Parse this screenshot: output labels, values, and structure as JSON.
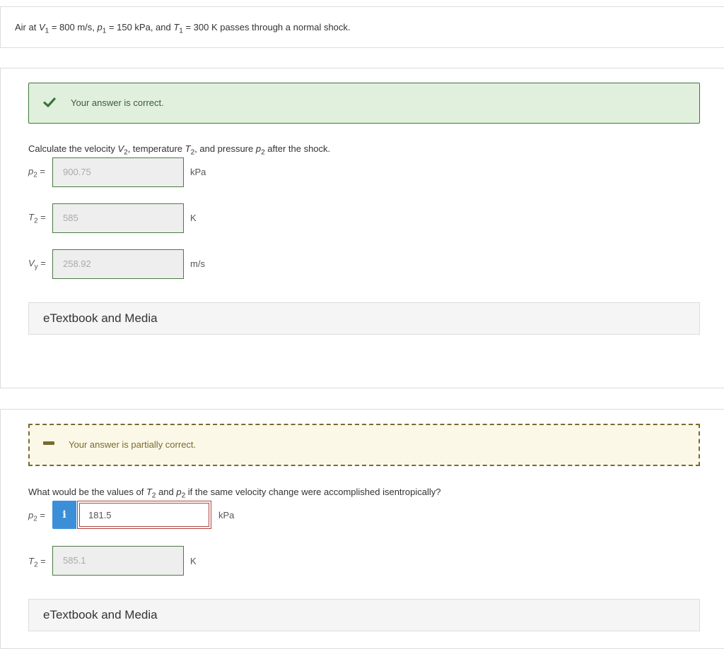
{
  "problem": {
    "prefix": "Air at ",
    "v1_sym": "V",
    "v1_sub": "1",
    "v1_val": " = 800 m/s, ",
    "p1_sym": "p",
    "p1_sub": "1",
    "p1_val": " = 150 kPa, and ",
    "t1_sym": "T",
    "t1_sub": "1",
    "t1_val": " = 300 K passes through a normal shock."
  },
  "part1": {
    "banner_text": "Your answer is correct.",
    "q_a": "Calculate the velocity ",
    "q_v": "V",
    "q_v_sub": "2",
    "q_b": ", temperature ",
    "q_t": "T",
    "q_t_sub": "2",
    "q_c": ", and pressure ",
    "q_p": "p",
    "q_p_sub": "2",
    "q_d": " after the shock.",
    "rows": [
      {
        "sym": "p",
        "sub": "2",
        "eq": " =",
        "value": "900.75",
        "unit": "kPa"
      },
      {
        "sym": "T",
        "sub": "2",
        "eq": " =",
        "value": "585",
        "unit": "K"
      },
      {
        "sym": "V",
        "sub": "y",
        "eq": " =",
        "value": "258.92",
        "unit": "m/s"
      }
    ],
    "media_label": "eTextbook and Media"
  },
  "part2": {
    "banner_text": "Your answer is partially correct.",
    "q_a": "What would be the values of ",
    "q_t": "T",
    "q_t_sub": "2",
    "q_b": " and ",
    "q_p": "p",
    "q_p_sub": "2",
    "q_c": " if the same velocity change were accomplished isentropically?",
    "row_p": {
      "sym": "p",
      "sub": "2",
      "eq": " =",
      "info": "i",
      "value": "181.5",
      "unit": "kPa"
    },
    "row_t": {
      "sym": "T",
      "sub": "2",
      "eq": " =",
      "value": "585.1",
      "unit": "K"
    },
    "media_label": "eTextbook and Media"
  },
  "colors": {
    "correct_bg": "#e1f0dc",
    "correct_border": "#3c763d",
    "partial_bg": "#fcf8e8",
    "partial_border": "#7a6a30",
    "info_blue": "#3b8fd9",
    "error_red": "#a94442"
  },
  "icons": {
    "correct": "check-icon",
    "partial": "minus-icon",
    "info": "info-icon"
  }
}
